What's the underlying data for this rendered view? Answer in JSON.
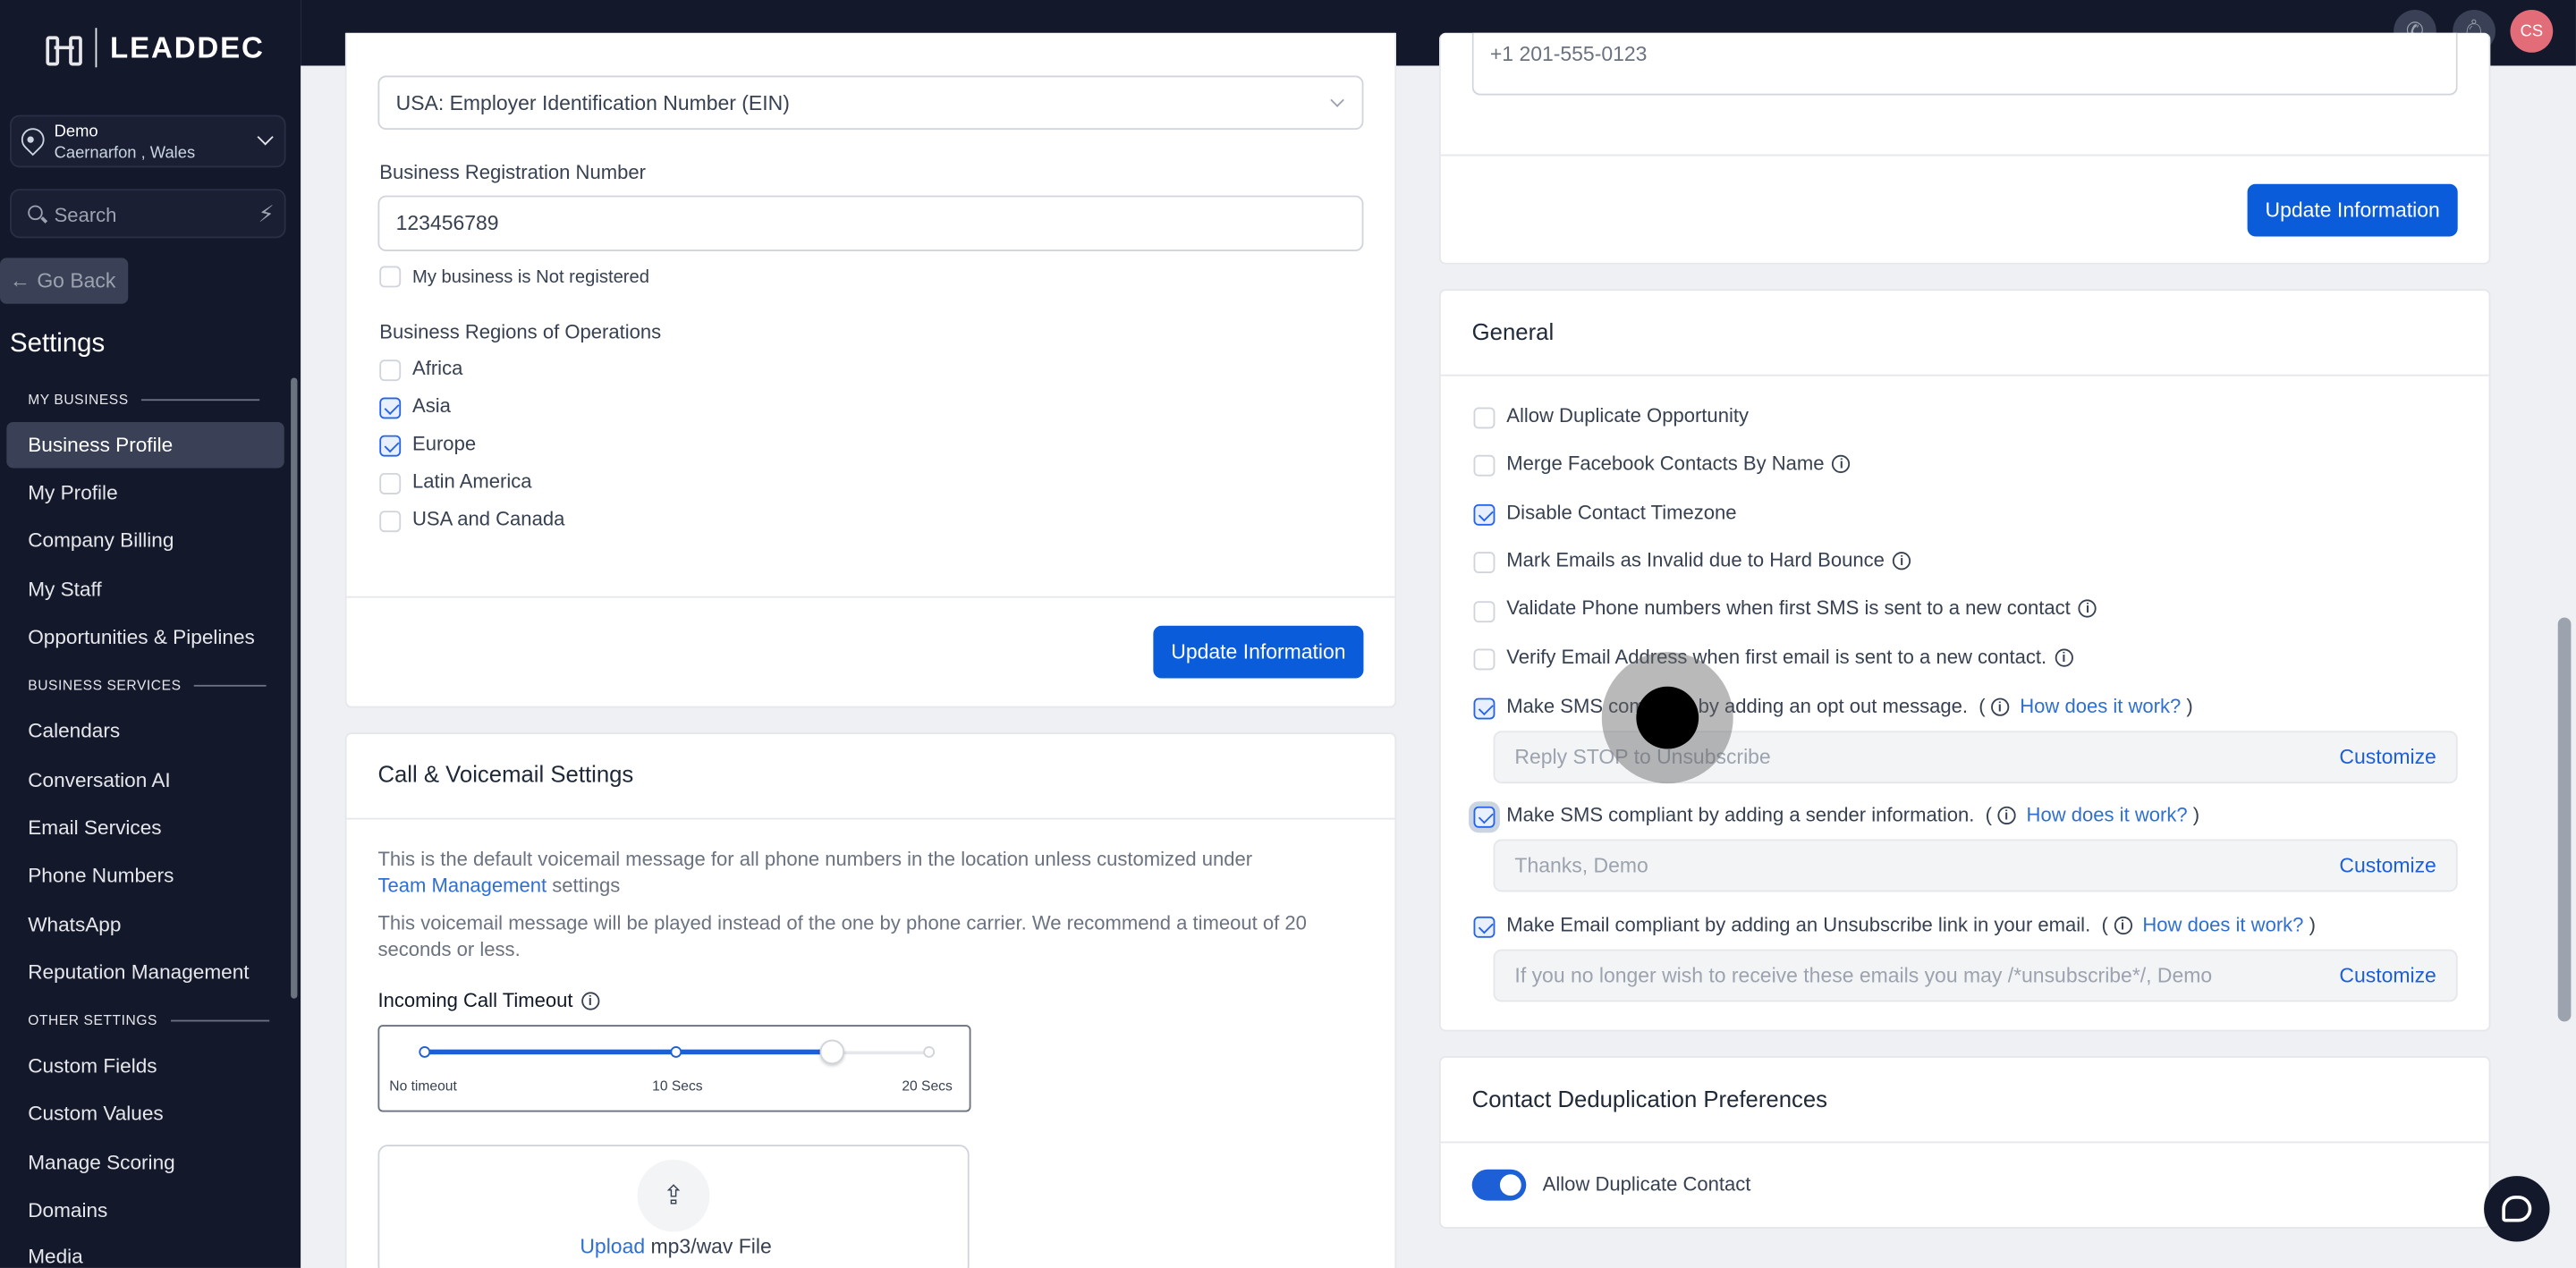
{
  "brand": {
    "name": "LEADDEC"
  },
  "location": {
    "name": "Demo",
    "place": "Caernarfon , Wales"
  },
  "search": {
    "placeholder": "Search"
  },
  "sidebar": {
    "go_back": "Go Back",
    "title": "Settings",
    "sections": {
      "my_business": "MY BUSINESS",
      "business_services": "BUSINESS SERVICES",
      "other_settings": "OTHER SETTINGS"
    },
    "items": {
      "business_profile": "Business Profile",
      "my_profile": "My Profile",
      "company_billing": "Company Billing",
      "my_staff": "My Staff",
      "opportunities": "Opportunities & Pipelines",
      "calendars": "Calendars",
      "conversation_ai": "Conversation AI",
      "email_services": "Email Services",
      "phone_numbers": "Phone Numbers",
      "whatsapp": "WhatsApp",
      "reputation": "Reputation Management",
      "custom_fields": "Custom Fields",
      "custom_values": "Custom Values",
      "manage_scoring": "Manage Scoring",
      "domains": "Domains",
      "media": "Media"
    }
  },
  "topbar": {
    "avatar_initials": "CS"
  },
  "business": {
    "id_type_value": "USA: Employer Identification Number (EIN)",
    "reg_number_label": "Business Registration Number",
    "reg_number_value": "123456789",
    "not_registered_label": "My business is Not registered",
    "regions_label": "Business Regions of Operations",
    "regions": {
      "africa": "Africa",
      "asia": "Asia",
      "europe": "Europe",
      "latin_america": "Latin America",
      "usa_canada": "USA and Canada"
    },
    "update_button": "Update Information"
  },
  "call": {
    "title": "Call & Voicemail Settings",
    "desc1": "This is the default voicemail message for all phone numbers in the location unless customized under",
    "desc1_link": "Team Management",
    "desc1_tail": "settings",
    "desc2": "This voicemail message will be played instead of the one by phone carrier. We recommend a timeout of 20 seconds or less.",
    "timeout_label": "Incoming Call Timeout",
    "ticks": {
      "min": "No timeout",
      "mid": "10 Secs",
      "max": "20 Secs"
    },
    "timeout_value": 16,
    "upload_link": "Upload",
    "upload_tail": "mp3/wav File"
  },
  "phone": {
    "value": "+1 201-555-0123",
    "update_button": "Update Information"
  },
  "general": {
    "title": "General",
    "opts": {
      "dup_opp": "Allow Duplicate Opportunity",
      "merge_fb": "Merge Facebook Contacts By Name",
      "disable_tz": "Disable Contact Timezone",
      "mark_invalid": "Mark Emails as Invalid due to Hard Bounce",
      "validate_phone": "Validate Phone numbers when first SMS is sent to a new contact",
      "verify_email": "Verify Email Address when first email is sent to a new contact.",
      "sms_optout": "Make SMS compliant by adding an opt out message.",
      "sms_sender": "Make SMS compliant by adding a sender information.",
      "email_unsub": "Make Email compliant by adding an Unsubscribe link in your email."
    },
    "how_link": "How does it work?",
    "optout_placeholder": "Reply STOP to Unsubscribe",
    "sender_placeholder": "Thanks, Demo",
    "unsub_placeholder": "If you no longer wish to receive these emails you may /*unsubscribe*/, Demo",
    "customize": "Customize"
  },
  "dedupe": {
    "title": "Contact Deduplication Preferences",
    "allow_dup": "Allow Duplicate Contact"
  }
}
